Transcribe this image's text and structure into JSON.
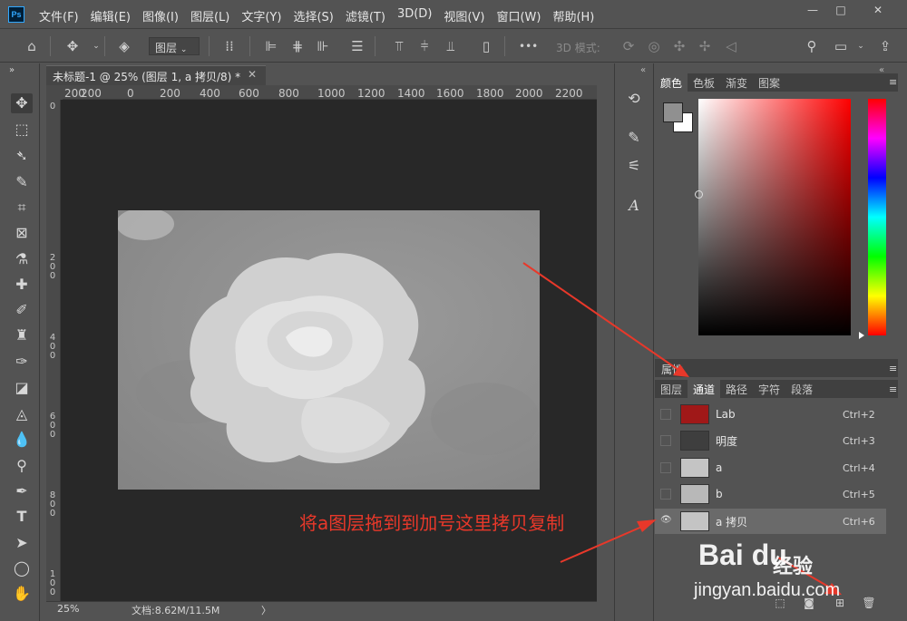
{
  "app": {
    "logo": "Ps"
  },
  "menu": [
    "文件(F)",
    "编辑(E)",
    "图像(I)",
    "图层(L)",
    "文字(Y)",
    "选择(S)",
    "滤镜(T)",
    "3D(D)",
    "视图(V)",
    "窗口(W)",
    "帮助(H)"
  ],
  "window_controls": {
    "minimize": "—",
    "maximize": "□",
    "close": "✕"
  },
  "options": {
    "layer_select": "图层",
    "mode_3d": "3D 模式:",
    "more": "•••"
  },
  "document": {
    "tab_title": "未标题-1 @ 25% (图层 1, a 拷贝/8) *",
    "close": "✕",
    "ruler_h": [
      "200",
      "0",
      "200",
      "400",
      "600",
      "800",
      "1000",
      "1200",
      "1400",
      "1600",
      "1800",
      "2000",
      "2200"
    ],
    "ruler_v": [
      "0",
      "2",
      "0",
      "0",
      "4",
      "0",
      "0",
      "6",
      "0",
      "0",
      "8",
      "0",
      "0",
      "1",
      "0",
      "0",
      "0"
    ],
    "zoom": "25%",
    "doc_info": "文档:8.62M/11.5M",
    "status_arrow": "〉"
  },
  "color_panel": {
    "tabs": [
      "颜色",
      "色板",
      "渐变",
      "图案"
    ],
    "active_tab": "颜色"
  },
  "properties_label": "属性",
  "channel_panel": {
    "tabs": [
      "图层",
      "通道",
      "路径",
      "字符",
      "段落"
    ],
    "active_tab": "通道",
    "rows": [
      {
        "name": "Lab",
        "shortcut": "Ctrl+2",
        "visible": "",
        "thumb_color": "#a01818"
      },
      {
        "name": "明度",
        "shortcut": "Ctrl+3",
        "visible": "",
        "thumb_color": "#3e3e3e"
      },
      {
        "name": "a",
        "shortcut": "Ctrl+4",
        "visible": "",
        "thumb_color": "#c4c4c4"
      },
      {
        "name": "b",
        "shortcut": "Ctrl+5",
        "visible": "",
        "thumb_color": "#b8b8b8"
      },
      {
        "name": "a 拷贝",
        "shortcut": "Ctrl+6",
        "visible": "👁",
        "thumb_color": "#c4c4c4"
      }
    ]
  },
  "annotation": "将a图层拖到到加号这里拷贝复制",
  "watermark": {
    "brand": "Bai du",
    "brand_cn": "经验",
    "url": "jingyan.baidu.com"
  },
  "panel_menu": "≡",
  "collapse": "»",
  "collapse_left": "«"
}
